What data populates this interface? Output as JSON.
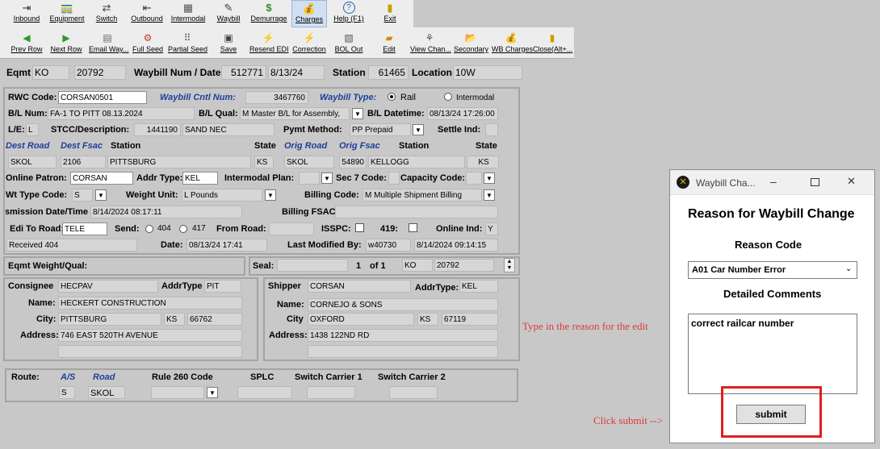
{
  "toolbar_main": [
    {
      "label": "Inbound",
      "icon": "inbound-icon"
    },
    {
      "label": "Equipment",
      "icon": "equipment-icon"
    },
    {
      "label": "Switch",
      "icon": "switch-icon"
    },
    {
      "label": "Outbound",
      "icon": "outbound-icon"
    },
    {
      "label": "Intermodal",
      "icon": "intermodal-icon"
    },
    {
      "label": "Waybill",
      "icon": "waybill-icon"
    },
    {
      "label": "Demurrage",
      "icon": "demurrage-icon"
    },
    {
      "label": "Charges",
      "icon": "charges-icon"
    },
    {
      "label": "Help (F1)",
      "icon": "help-icon"
    },
    {
      "label": "Exit",
      "icon": "exit-icon"
    }
  ],
  "toolbar_actions": [
    {
      "label": "Prev Row",
      "icon": "prev-row-icon"
    },
    {
      "label": "Next Row",
      "icon": "next-row-icon"
    },
    {
      "label": "Email Way...",
      "icon": "email-icon"
    },
    {
      "label": "Full Seed",
      "icon": "full-seed-icon"
    },
    {
      "label": "Partial Seed",
      "icon": "partial-seed-icon"
    },
    {
      "label": "Save",
      "icon": "save-icon"
    },
    {
      "label": "Resend EDI",
      "icon": "resend-edi-icon"
    },
    {
      "label": "Correction",
      "icon": "correction-icon"
    },
    {
      "label": "BOL Out",
      "icon": "bol-out-icon"
    },
    {
      "label": "Edit",
      "icon": "edit-icon"
    },
    {
      "label": "View Chan...",
      "icon": "view-changes-icon"
    },
    {
      "label": "Secondary",
      "icon": "secondary-icon"
    },
    {
      "label": "WB Charges",
      "icon": "wb-charges-icon"
    },
    {
      "label": "Close(Alt+...",
      "icon": "close-icon"
    }
  ],
  "header": {
    "eqmt_label": "Eqmt",
    "eqmt_road": "KO",
    "eqmt_num": "20792",
    "waybill_label": "Waybill Num / Date",
    "waybill_num": "512771",
    "waybill_date": "8/13/24",
    "station_label": "Station",
    "station_num": "61465",
    "location_label": "Location",
    "location_val": "10W"
  },
  "form": {
    "rwc_label": "RWC Code:",
    "rwc_val": "CORSAN0501",
    "cntl_label": "Waybill Cntl Num:",
    "cntl_val": "3467760",
    "type_label": "Waybill Type:",
    "type_rail": "Rail",
    "type_intermodal": "Intermodal",
    "bl_num_label": "B/L Num:",
    "bl_num_val": "FA-1 TO PITT 08.13.2024",
    "bl_qual_label": "B/L Qual:",
    "bl_qual_val": "M Master B/L for Assembly,",
    "bl_dt_label": "B/L Datetime:",
    "bl_dt_val": "08/13/24 17:26:00",
    "le_label": "L/E:",
    "le_val": "L",
    "stcc_label": "STCC/Description:",
    "stcc_val": "1441190",
    "stcc_desc": "SAND NEC",
    "pymt_label": "Pymt Method:",
    "pymt_val": "PP Prepaid",
    "settle_label": "Settle Ind:",
    "dest_road_label": "Dest Road",
    "dest_fsac_label": "Dest Fsac",
    "station_label": "Station",
    "state_label": "State",
    "orig_road_label": "Orig Road",
    "orig_fsac_label": "Orig Fsac",
    "station2_label": "Station",
    "state2_label": "State",
    "dest_road": "SKOL",
    "dest_fsac": "2106",
    "dest_station": "PITTSBURG",
    "dest_state": "KS",
    "orig_road": "SKOL",
    "orig_fsac": "54890",
    "orig_station": "KELLOGG",
    "orig_state": "KS",
    "online_patron_label": "Online Patron:",
    "online_patron_val": "CORSAN",
    "addr_type_label": "Addr Type:",
    "addr_type_val": "KEL",
    "interm_plan_label": "Intermodal Plan:",
    "sec7_label": "Sec 7 Code:",
    "capacity_label": "Capacity Code:",
    "wt_type_label": "Wt Type Code:",
    "wt_type_val": "S",
    "weight_unit_label": "Weight Unit:",
    "weight_unit_val": "L Pounds",
    "billing_label": "Billing Code:",
    "billing_val": "M Multiple Shipment Billing",
    "trans_label": "Transmission Date/Time:",
    "trans_val": "8/14/2024 08:17:11",
    "billing_fsac_label": "Billing FSAC:",
    "edi_label": "Edi To Road:",
    "edi_val": "TELE",
    "send_label": "Send:",
    "send_404": "404",
    "send_417": "417",
    "from_road_label": "From Road:",
    "isspc_label": "ISSPC:",
    "l419_label": "419:",
    "online_ind_label": "Online Ind:",
    "online_ind_val": "Y",
    "received_val": "Received 404",
    "date_label": "Date:",
    "date_val": "08/13/24 17:41",
    "modified_label": "Last Modified By:",
    "modified_user": "w40730",
    "modified_dt": "8/14/2024 09:14:15"
  },
  "weight": {
    "label": "Eqmt Weight/Qual:",
    "seal_label": "Seal:",
    "page_cur": "1",
    "page_of": "of 1",
    "road": "KO",
    "num": "20792"
  },
  "consignee": {
    "label": "Consignee",
    "code": "HECPAV",
    "addrtype_label": "AddrType",
    "addrtype": "PIT",
    "name_label": "Name:",
    "name": "HECKERT CONSTRUCTION",
    "city_label": "City:",
    "city": "PITTSBURG",
    "state": "KS",
    "zip": "66762",
    "address_label": "Address:",
    "address": "746 EAST 520TH AVENUE"
  },
  "shipper": {
    "label": "Shipper",
    "code": "CORSAN",
    "addrtype_label": "AddrType:",
    "addrtype": "KEL",
    "name_label": "Name:",
    "name": "CORNEJO & SONS",
    "city_label": "City",
    "city": "OXFORD",
    "state": "KS",
    "zip": "67119",
    "address_label": "Address:",
    "address": "1438 122ND RD"
  },
  "route": {
    "label": "Route:",
    "as_label": "A/S",
    "road_label": "Road",
    "rule_label": "Rule 260 Code",
    "splc_label": "SPLC",
    "sw1_label": "Switch Carrier 1",
    "sw2_label": "Switch Carrier 2",
    "as_val": "S",
    "road_val": "SKOL"
  },
  "dialog": {
    "title": "Waybill Cha...",
    "heading": "Reason for Waybill Change",
    "reason_label": "Reason Code",
    "reason_val": "A01 Car Number Error",
    "comments_label": "Detailed Comments",
    "comments_val": "correct railcar number",
    "submit_label": "submit"
  },
  "annotations": {
    "edit_note": "Type in the reason for the edit",
    "submit_note": "Click submit -->"
  },
  "colors": {
    "highlight": "#e02020",
    "note": "#e03838",
    "blue_label": "#1f3f99"
  }
}
